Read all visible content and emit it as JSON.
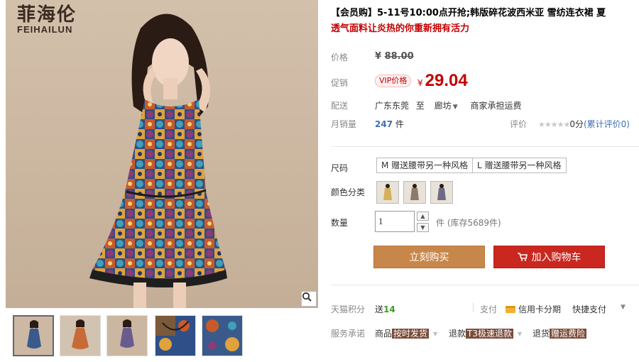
{
  "brand": {
    "name_cn": "菲海伦",
    "name_en": "FEIHAILUN"
  },
  "product": {
    "title_main": "【会员购】5-11号10:00点开抢;韩版碎花波西米亚 雪纺连衣裙 夏",
    "title_sub": "透气面料让炎热的你重新拥有活力"
  },
  "price": {
    "label": "价格",
    "currency": "¥",
    "original": "88.00"
  },
  "promo": {
    "label": "促销",
    "badge": "VIP价格",
    "currency": "¥",
    "price": "29.04"
  },
  "shipping": {
    "label": "配送",
    "from": "广东东莞",
    "to_word": "至",
    "destination": "廊坊",
    "dropdown_arrow": "▼",
    "note": "商家承担运费"
  },
  "sales": {
    "label": "月销量",
    "count": "247",
    "unit": "件"
  },
  "rating": {
    "label": "评价",
    "stars": "★★★★★",
    "score": "0分",
    "link": "(累计评价0)"
  },
  "size": {
    "label": "尺码",
    "options": [
      "M 赠送腰带另一种风格",
      "L 赠送腰带另一种风格"
    ]
  },
  "color": {
    "label": "颜色分类",
    "swatch_colors": [
      "#d7b05a",
      "#8e7a6a",
      "#6f6a86"
    ]
  },
  "quantity": {
    "label": "数量",
    "value": "1",
    "stock": "件 (库存5689件)"
  },
  "actions": {
    "buy_now": "立刻购买",
    "add_to_cart": "加入购物车"
  },
  "points": {
    "label": "天猫积分",
    "prefix": "送",
    "value": "14"
  },
  "payment": {
    "label": "支付",
    "credit": "信用卡分期",
    "quick": "快捷支付"
  },
  "service": {
    "label": "服务承诺",
    "items": [
      {
        "prefix": "商品",
        "tag": "按时发货"
      },
      {
        "prefix": "退款",
        "tag": "T3极速退款"
      },
      {
        "prefix": "退货",
        "tag": "赠运费险"
      }
    ]
  },
  "colors": {
    "accent_red": "#c40000",
    "buy_button": "#c8874a",
    "cart_button": "#c9271f",
    "link_blue": "#3d6fb5"
  }
}
